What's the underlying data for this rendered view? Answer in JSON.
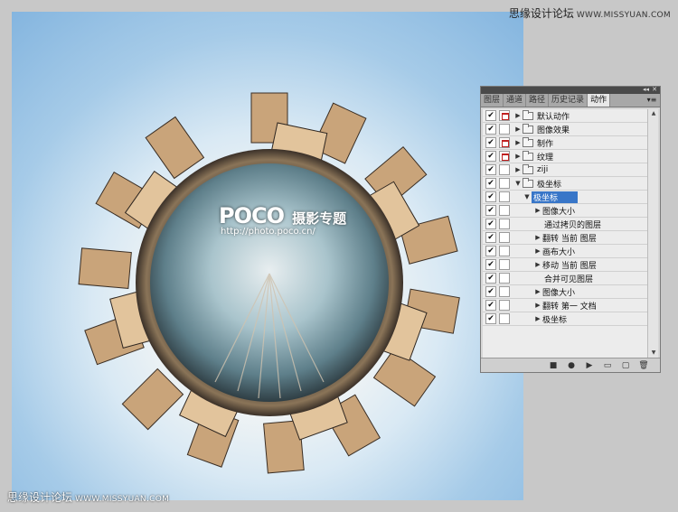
{
  "watermarks": {
    "top_text": "思缘设计论坛",
    "top_url": "WWW.MISSYUAN.COM",
    "bottom_text": "思缘设计论坛",
    "bottom_url": "WWW.MISSYUAN.COM"
  },
  "logo": {
    "brand": "POCO",
    "title": "摄影专题",
    "url": "http://photo.poco.cn/"
  },
  "panel": {
    "collapse_glyph": "◂◂",
    "close_glyph": "✕",
    "menu_glyph": "▾≡",
    "tabs": [
      {
        "label": "图层",
        "active": false
      },
      {
        "label": "通道",
        "active": false
      },
      {
        "label": "路径",
        "active": false
      },
      {
        "label": "历史记录",
        "active": false
      },
      {
        "label": "动作",
        "active": true
      }
    ],
    "rows": [
      {
        "label": "默认动作",
        "check": "✔",
        "dialog": true,
        "type": "set",
        "expanded": false
      },
      {
        "label": "图像效果",
        "check": "✔",
        "dialog": false,
        "type": "set",
        "expanded": false
      },
      {
        "label": "制作",
        "check": "✔",
        "dialog": true,
        "type": "set",
        "expanded": false
      },
      {
        "label": "纹理",
        "check": "✔",
        "dialog": true,
        "type": "set",
        "expanded": false
      },
      {
        "label": "ziji",
        "check": "✔",
        "dialog": false,
        "type": "set",
        "expanded": false
      },
      {
        "label": "极坐标",
        "check": "✔",
        "dialog": false,
        "type": "set",
        "expanded": true
      },
      {
        "label": "极坐标",
        "check": "✔",
        "dialog": false,
        "type": "action",
        "expanded": true,
        "selected": true
      },
      {
        "label": "图像大小",
        "check": "✔",
        "dialog": false,
        "type": "step",
        "expandable": true
      },
      {
        "label": "通过拷贝的图层",
        "check": "✔",
        "dialog": false,
        "type": "step",
        "expandable": false
      },
      {
        "label": "翻转 当前 图层",
        "check": "✔",
        "dialog": false,
        "type": "step",
        "expandable": true
      },
      {
        "label": "画布大小",
        "check": "✔",
        "dialog": false,
        "type": "step",
        "expandable": true
      },
      {
        "label": "移动 当前 图层",
        "check": "✔",
        "dialog": false,
        "type": "step",
        "expandable": true
      },
      {
        "label": "合并可见图层",
        "check": "✔",
        "dialog": false,
        "type": "step",
        "expandable": false
      },
      {
        "label": "图像大小",
        "check": "✔",
        "dialog": false,
        "type": "step",
        "expandable": true
      },
      {
        "label": "翻转 第一 文档",
        "check": "✔",
        "dialog": false,
        "type": "step",
        "expandable": true
      },
      {
        "label": "极坐标",
        "check": "✔",
        "dialog": false,
        "type": "step",
        "expandable": true
      }
    ],
    "toolbar_icons": [
      {
        "name": "stop-icon",
        "glyph": "■"
      },
      {
        "name": "record-icon",
        "glyph": "●"
      },
      {
        "name": "play-icon",
        "glyph": "▶"
      },
      {
        "name": "new-set-icon",
        "glyph": "▭"
      },
      {
        "name": "new-action-icon",
        "glyph": "▢"
      },
      {
        "name": "delete-icon",
        "glyph": "🗑"
      }
    ]
  }
}
